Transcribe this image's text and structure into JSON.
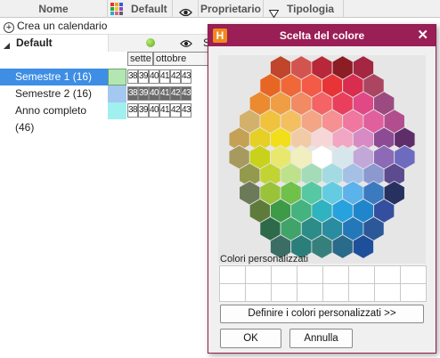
{
  "header": {
    "name_col": "Nome",
    "default_col": "Default",
    "owner_col": "Proprietario",
    "type_col": "Tipologia"
  },
  "toolbar": {
    "create_calendar": "Crea un calendario"
  },
  "groups": [
    {
      "label": "Default",
      "rows": [
        {
          "label": "Semestre 1 (16)",
          "selected": true,
          "color": "#b4e6b4"
        },
        {
          "label": "Semestre 2 (16)",
          "selected": false,
          "color": "#a4c8f0"
        },
        {
          "label": "Anno completo (46)",
          "selected": false,
          "color": "#a0f0f0"
        }
      ]
    }
  ],
  "calendar": {
    "months": [
      "sette",
      "ottobre",
      "S"
    ],
    "weeks": [
      "38",
      "39",
      "40",
      "41",
      "42",
      "43"
    ],
    "dark_rows": [
      false,
      true,
      false
    ]
  },
  "dialog": {
    "title": "Scelta del colore",
    "custom_label": "Colori personalizzati",
    "define_button": "Definire i colori personalizzati >>",
    "ok_button": "OK",
    "cancel_button": "Annulla",
    "hex_colors": [
      [
        "#c0452a",
        "#d3544e",
        "#b8283a",
        "#8c1d24",
        "#a42642"
      ],
      [
        "#e86623",
        "#f06837",
        "#f35a47",
        "#e83436",
        "#d82d4e",
        "#ab4562"
      ],
      [
        "#eb8a2f",
        "#f09e44",
        "#f28a63",
        "#f46365",
        "#ea3f5c",
        "#e14886",
        "#9c4b80"
      ],
      [
        "#d4b16b",
        "#f0c23e",
        "#f4bf61",
        "#f4a585",
        "#f69092",
        "#ef77a0",
        "#e05f9c",
        "#b24e8e"
      ],
      [
        "#c4a155",
        "#e6d026",
        "#f2de1a",
        "#f2caa6",
        "#f6d6d6",
        "#f1a6c3",
        "#d88ac4",
        "#8d4b96",
        "#5e2d6a"
      ],
      [
        "#a79a5e",
        "#c9d21a",
        "#e8e86e",
        "#f1efbd",
        "#ffffff",
        "#d6e6ec",
        "#c2a8d8",
        "#8d6ab6",
        "#6c6bbf"
      ],
      [
        "#93994d",
        "#c2d334",
        "#bde28a",
        "#a4dbb8",
        "#a2dce2",
        "#a4c0e4",
        "#8c98d0",
        "#5c4b8e"
      ],
      [
        "#6c7a5a",
        "#9ac33a",
        "#70c14a",
        "#56c8a2",
        "#64cce2",
        "#5cb2ea",
        "#3c7ac0",
        "#27315f"
      ],
      [
        "#5f7b3b",
        "#3d9b48",
        "#44b37f",
        "#2fb3c0",
        "#26a2de",
        "#1f86cc",
        "#354fa0"
      ],
      [
        "#2d6a4a",
        "#40a36a",
        "#2b8c88",
        "#2a8ca0",
        "#2278b8",
        "#2a5898"
      ],
      [
        "#3c6d64",
        "#2a7f7a",
        "#36807c",
        "#2a6a8a",
        "#1e4f9a"
      ]
    ]
  }
}
